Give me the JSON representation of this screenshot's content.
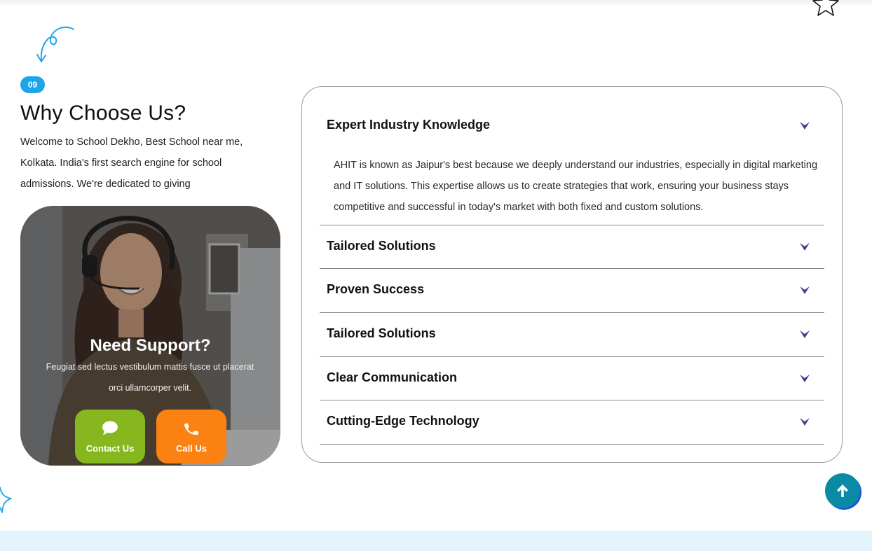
{
  "section": {
    "badge": "09",
    "heading": "Why Choose Us?",
    "intro": "Welcome to School Dekho, Best School near me, Kolkata. India's first search engine for school admissions. We're dedicated to giving"
  },
  "support": {
    "title": "Need Support?",
    "text": "Feugiat sed lectus vestibulum mattis fusce ut placerat orci ullamcorper velit.",
    "contact_label": "Contact Us",
    "call_label": "Call Us"
  },
  "faq": {
    "items": [
      {
        "question": "Expert Industry Knowledge",
        "expanded": true,
        "answer": "AHIT is known as Jaipur's best because we deeply understand our industries, especially in digital marketing and IT solutions. This expertise allows us to create strategies that work, ensuring your business stays competitive and successful in today's market with both fixed and custom solutions."
      },
      {
        "question": "Tailored Solutions",
        "expanded": false
      },
      {
        "question": "Proven Success",
        "expanded": false
      },
      {
        "question": "Tailored Solutions",
        "expanded": false
      },
      {
        "question": "Clear Communication",
        "expanded": false
      },
      {
        "question": "Cutting-Edge Technology",
        "expanded": false
      }
    ]
  },
  "colors": {
    "badge": "#1ea5e9",
    "contact_button": "#86b71e",
    "call_button": "#fb8212",
    "scroll_top": "#0b8aa6",
    "chevron": "#3b3f8c",
    "bottom_band": "#e2f3fc"
  },
  "icons": {
    "decor_arrow": "curly-arrow-icon",
    "decor_star": "star-outline-icon",
    "contact": "chat-bubble-icon",
    "call": "phone-icon",
    "faq_toggle": "chevron-down-icon",
    "scroll_top": "arrow-up-icon"
  }
}
